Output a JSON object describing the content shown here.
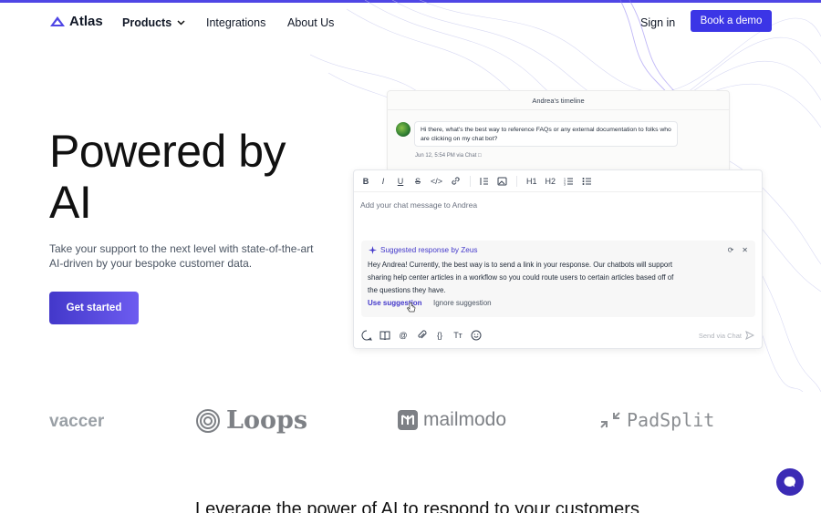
{
  "brand": {
    "name": "Atlas",
    "accent": "#3b35e6"
  },
  "nav": {
    "products": "Products",
    "integrations": "Integrations",
    "about": "About Us",
    "sign_in": "Sign in",
    "book_demo": "Book a demo"
  },
  "hero": {
    "title_line1": "Powered by",
    "title_line2": "AI",
    "subtitle": "Take your support to the next level with state-of-the-art AI-driven by your bespoke customer data.",
    "cta": "Get started"
  },
  "timeline": {
    "title": "Andrea's timeline",
    "message": "Hi there, what's the best way to reference FAQs or any external documentation to folks who are clicking on my chat bot?",
    "meta": "Jun 12, 5:54 PM via Chat"
  },
  "composer": {
    "toolbar": [
      "B",
      "I",
      "U",
      "S",
      "</>",
      "link",
      "quote",
      "image",
      "H1",
      "H2",
      "ordered-list",
      "bullet-list"
    ],
    "placeholder": "Add your chat message to Andrea",
    "suggestion": {
      "title": "Suggested response by Zeus",
      "body": "Hey Andrea! Currently, the best way is to send a link in your response. Our chatbots will support sharing help center articles in a workflow so you could route users to certain articles based off of the questions they have.",
      "use": "Use suggestion",
      "ignore": "Ignore suggestion"
    },
    "send": "Send via Chat"
  },
  "logos": [
    "vaccer",
    "Loops",
    "mailmodo",
    "PadSplit"
  ],
  "bottom_heading": "Leverage the power of AI to respond to your customers"
}
